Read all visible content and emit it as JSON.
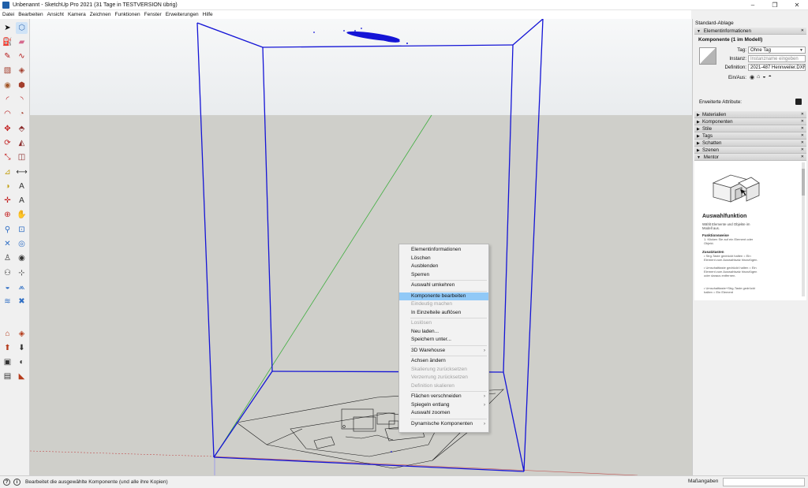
{
  "window": {
    "title": "Unbenannt - SketchUp Pro 2021 (31 Tage in TESTVERSION übrig)",
    "min": "–",
    "max": "❐",
    "close": "✕"
  },
  "menubar": [
    "Datei",
    "Bearbeiten",
    "Ansicht",
    "Kamera",
    "Zeichnen",
    "Funktionen",
    "Fenster",
    "Erweiterungen",
    "Hilfe"
  ],
  "toolbar": {
    "tools": [
      {
        "name": "select",
        "glyph": "➤",
        "color": "#111"
      },
      {
        "name": "make-component",
        "glyph": "⬡",
        "color": "#3c6fb3"
      },
      {
        "name": "paint-bucket",
        "glyph": "⛽",
        "color": "#c47a1a"
      },
      {
        "name": "eraser",
        "glyph": "▰",
        "color": "#d66a8e"
      },
      {
        "name": "line",
        "glyph": "✎",
        "color": "#b51c1c"
      },
      {
        "name": "freehand",
        "glyph": "∿",
        "color": "#b51c1c"
      },
      {
        "name": "rectangle",
        "glyph": "▧",
        "color": "#a33d2b"
      },
      {
        "name": "rotated-rectangle",
        "glyph": "◈",
        "color": "#a33d2b"
      },
      {
        "name": "circle",
        "glyph": "◉",
        "color": "#a3592b"
      },
      {
        "name": "polygon",
        "glyph": "⬢",
        "color": "#a33d2b"
      },
      {
        "name": "arc",
        "glyph": "◜",
        "color": "#b51c1c"
      },
      {
        "name": "two-point-arc",
        "glyph": "◝",
        "color": "#b51c1c"
      },
      {
        "name": "three-point-arc",
        "glyph": "◠",
        "color": "#b51c1c"
      },
      {
        "name": "pie",
        "glyph": "◔",
        "color": "#a33d2b"
      },
      {
        "name": "move",
        "glyph": "✥",
        "color": "#c21d1d"
      },
      {
        "name": "push-pull",
        "glyph": "⬘",
        "color": "#8a2b2b"
      },
      {
        "name": "rotate",
        "glyph": "⟳",
        "color": "#c21d1d"
      },
      {
        "name": "follow-me",
        "glyph": "◭",
        "color": "#8a2b2b"
      },
      {
        "name": "scale",
        "glyph": "⤡",
        "color": "#c21d1d"
      },
      {
        "name": "offset",
        "glyph": "◫",
        "color": "#8a2b2b"
      },
      {
        "name": "tape-measure",
        "glyph": "⊿",
        "color": "#c4a21a"
      },
      {
        "name": "dimension",
        "glyph": "⟷",
        "color": "#333"
      },
      {
        "name": "protractor",
        "glyph": "◑",
        "color": "#c4a21a"
      },
      {
        "name": "text",
        "glyph": "A",
        "color": "#333"
      },
      {
        "name": "axes",
        "glyph": "✛",
        "color": "#c21d1d"
      },
      {
        "name": "3d-text",
        "glyph": "A",
        "color": "#333"
      },
      {
        "name": "orbit",
        "glyph": "⊕",
        "color": "#c21d1d"
      },
      {
        "name": "pan",
        "glyph": "✋",
        "color": "#c4a21a"
      },
      {
        "name": "zoom",
        "glyph": "⚲",
        "color": "#2f6ec4"
      },
      {
        "name": "zoom-window",
        "glyph": "⊡",
        "color": "#2f6ec4"
      },
      {
        "name": "zoom-extents",
        "glyph": "✕",
        "color": "#2f6ec4"
      },
      {
        "name": "previous-view",
        "glyph": "◎",
        "color": "#2f6ec4"
      },
      {
        "name": "position-camera",
        "glyph": "♙",
        "color": "#333"
      },
      {
        "name": "look-around",
        "glyph": "◉",
        "color": "#333"
      },
      {
        "name": "walk",
        "glyph": "⚇",
        "color": "#333"
      },
      {
        "name": "section-plane",
        "glyph": "⊹",
        "color": "#333"
      },
      {
        "name": "sandbox-from-contours",
        "glyph": "◒",
        "color": "#2f6ec4"
      },
      {
        "name": "sandbox-from-scratch",
        "glyph": "⩕",
        "color": "#2f6ec4"
      },
      {
        "name": "smoove",
        "glyph": "≋",
        "color": "#2f6ec4"
      },
      {
        "name": "stamp",
        "glyph": "✖",
        "color": "#2f6ec4"
      },
      {
        "name": "warehouse",
        "glyph": "⌂",
        "color": "#b53c1c"
      },
      {
        "name": "extension-warehouse",
        "glyph": "◈",
        "color": "#b53c1c"
      },
      {
        "name": "share-model",
        "glyph": "⬆",
        "color": "#b53c1c"
      },
      {
        "name": "get-models",
        "glyph": "⬇",
        "color": "#333"
      },
      {
        "name": "extension-manager",
        "glyph": "▣",
        "color": "#333"
      },
      {
        "name": "trimble-connect",
        "glyph": "◐",
        "color": "#333"
      },
      {
        "name": "layout",
        "glyph": "▤",
        "color": "#333"
      },
      {
        "name": "style-builder",
        "glyph": "◣",
        "color": "#b53c1c"
      }
    ]
  },
  "context_menu": {
    "items": [
      {
        "label": "Elementinformationen",
        "state": "normal",
        "sub": ""
      },
      {
        "label": "Löschen",
        "state": "normal",
        "sub": ""
      },
      {
        "label": "Ausblenden",
        "state": "normal",
        "sub": ""
      },
      {
        "label": "Sperren",
        "state": "normal",
        "sub": "",
        "sep_after": true
      },
      {
        "label": "Auswahl umkehren",
        "state": "normal",
        "sub": "",
        "sep_after": true
      },
      {
        "label": "Komponente bearbeiten",
        "state": "highlighted",
        "sub": ""
      },
      {
        "label": "Eindeutig machen",
        "state": "disabled",
        "sub": ""
      },
      {
        "label": "In Einzelteile auflösen",
        "state": "normal",
        "sub": "",
        "sep_after": true
      },
      {
        "label": "Loslösen",
        "state": "disabled",
        "sub": ""
      },
      {
        "label": "Neu laden...",
        "state": "normal",
        "sub": ""
      },
      {
        "label": "Speichern unter...",
        "state": "normal",
        "sub": "",
        "sep_after": true
      },
      {
        "label": "3D Warehouse",
        "state": "normal",
        "sub": "›",
        "sep_after": true
      },
      {
        "label": "Achsen ändern",
        "state": "normal",
        "sub": ""
      },
      {
        "label": "Skalierung zurücksetzen",
        "state": "disabled",
        "sub": ""
      },
      {
        "label": "Verzerrung zurücksetzen",
        "state": "disabled",
        "sub": ""
      },
      {
        "label": "Definition skalieren",
        "state": "disabled",
        "sub": "",
        "sep_after": true
      },
      {
        "label": "Flächen verschneiden",
        "state": "normal",
        "sub": "›"
      },
      {
        "label": "Spiegeln entlang",
        "state": "normal",
        "sub": "›"
      },
      {
        "label": "Auswahl zoomen",
        "state": "normal",
        "sub": "",
        "sep_after": true
      },
      {
        "label": "Dynamische Komponenten",
        "state": "normal",
        "sub": "›"
      }
    ]
  },
  "right_panel": {
    "title": "Standard-Ablage",
    "entity_info": {
      "header": "Elementinformationen",
      "name": "Komponente (1 im Modell)",
      "tag_label": "Tag:",
      "tag_value": "Ohne Tag",
      "instance_label": "Instanz:",
      "instance_placeholder": "Instanzname eingeben",
      "definition_label": "Definition:",
      "definition_value": "2021-487 Hennweiler.DXF#",
      "visibility_label": "Ein/Aus:",
      "advanced_label": "Erweiterte Attribute:"
    },
    "trays": [
      {
        "label": "Materialien",
        "open": false
      },
      {
        "label": "Komponenten",
        "open": false
      },
      {
        "label": "Stile",
        "open": false
      },
      {
        "label": "Tags",
        "open": false
      },
      {
        "label": "Schatten",
        "open": false
      },
      {
        "label": "Szenen",
        "open": false
      }
    ],
    "mentor": {
      "header": "Mentor",
      "title": "Auswahlfunktion",
      "subtitle": "Wählt Elemente und Objekte im Modell aus.",
      "h1": "Funktionsweise",
      "b1": "1. Klicken Sie auf ein Element oder Objekt.",
      "h2": "Zusatztasten",
      "b2a": "• Strg-Taste gedrückt halten = Ein Element zum Auswahlsatz hinzufügen.",
      "b2b": "• Umschalttaste gedrückt halten = Ein Element zum Auswahlsatz hinzufügen oder daraus entfernen.",
      "b2c": "• Umschalttaste+Strg-Taste gedrückt halten = Ein Element"
    }
  },
  "statusbar": {
    "text": "Bearbeitet die ausgewählte Komponente (und alle ihre Kopien)",
    "measurements_label": "Maßangaben",
    "help_icon": "?",
    "info_icon": "i"
  },
  "colors": {
    "selection_blue": "#1515d6",
    "axis_green": "#3fae3f",
    "axis_red": "#c05050",
    "menu_highlight": "#91c9f7",
    "ground": "#cfcfca",
    "sky": "#eceef0"
  }
}
